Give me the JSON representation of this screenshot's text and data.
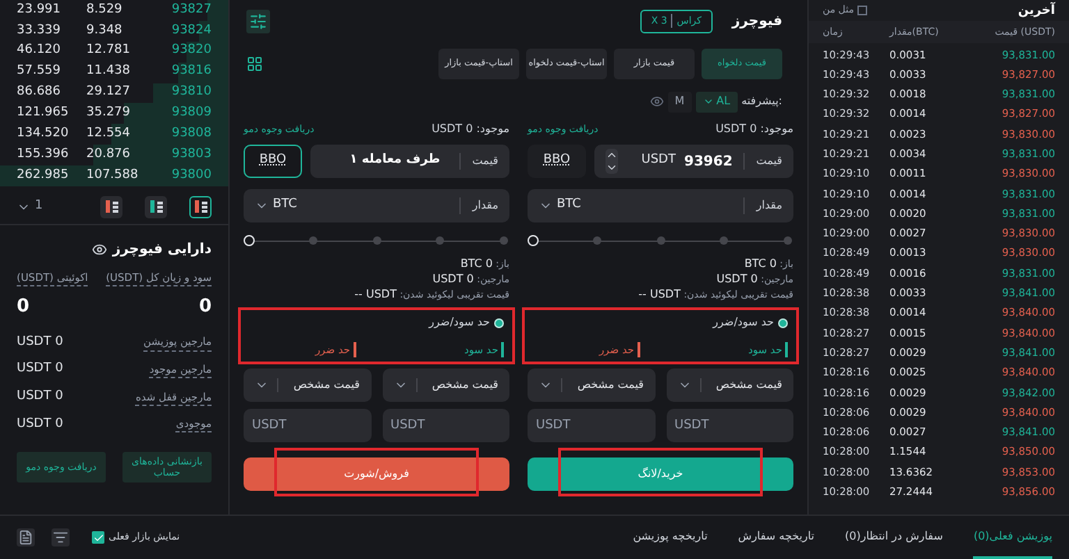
{
  "order_book": {
    "rows": [
      {
        "total": "23.991",
        "amount": "8.529",
        "price": "93827",
        "level": 0.09
      },
      {
        "total": "33.339",
        "amount": "9.348",
        "price": "93824",
        "level": 0.13
      },
      {
        "total": "46.120",
        "amount": "12.781",
        "price": "93820",
        "level": 0.18
      },
      {
        "total": "57.559",
        "amount": "11.438",
        "price": "93816",
        "level": 0.22
      },
      {
        "total": "86.686",
        "amount": "29.127",
        "price": "93810",
        "level": 0.33
      },
      {
        "total": "121.965",
        "amount": "35.279",
        "price": "93809",
        "level": 0.46
      },
      {
        "total": "134.520",
        "amount": "12.554",
        "price": "93808",
        "level": 0.51
      },
      {
        "total": "155.396",
        "amount": "20.876",
        "price": "93803",
        "level": 0.59
      },
      {
        "total": "262.985",
        "amount": "107.588",
        "price": "93800",
        "level": 1
      }
    ],
    "precision": "1",
    "layouts": [
      {
        "kind": "both",
        "selected": false
      },
      {
        "kind": "bids",
        "selected": false
      },
      {
        "kind": "asks",
        "selected": true
      }
    ]
  },
  "assets": {
    "title": "دارایی فیوچرز",
    "pnl_label": "سود و زیان کل (USDT)",
    "equity_label": "اکوئیتی (USDT)",
    "pnl": "0",
    "equity": "0",
    "rows": [
      {
        "label": "مارجین پوزیشن",
        "value": "USDT 0"
      },
      {
        "label": "مارجین موجود",
        "value": "USDT 0"
      },
      {
        "label": "مارجین قفل شده",
        "value": "USDT 0"
      },
      {
        "label": "موجودی",
        "value": "USDT 0"
      }
    ],
    "buttons": [
      "بازنشانی داده‌های حساب",
      "دریافت وجوه دمو"
    ]
  },
  "show_current_market": {
    "label": "نمایش بازار فعلی",
    "checked": true
  },
  "order_panel": {
    "title": "فیوچرز",
    "margin_mode": "کراس",
    "leverage": "X 3",
    "order_types": [
      {
        "label": "قیمت دلخواه",
        "selected": true
      },
      {
        "label": "قیمت بازار",
        "selected": false
      },
      {
        "label": "استاپ-قیمت دلخواه",
        "selected": false
      },
      {
        "label": "استاپ-قیمت بازار",
        "selected": false
      }
    ],
    "advanced_label": "پیشرفته:",
    "advanced_options": [
      {
        "label": "AL",
        "selected": true
      },
      {
        "label": "M",
        "selected": false
      }
    ],
    "sides": [
      {
        "kind": "buy",
        "available_label": "موجود:",
        "available": "USDT 0",
        "demo_link": "دریافت وجوه دمو",
        "price_label": "قیمت",
        "price": "93962",
        "price_unit": "USDT",
        "bbo": "BBO",
        "bbo_selected": false,
        "amount_label": "مقدار",
        "amount_unit": "BTC",
        "level": 0,
        "info": [
          {
            "label": "باز:",
            "value": "BTC 0"
          },
          {
            "label": "مارجین:",
            "value": "USDT 0"
          },
          {
            "label": "قیمت تقریبی لیکوئید شدن:",
            "value": "-- USDT"
          }
        ],
        "tpsl": {
          "label": "حد سود/ضرر",
          "on": true,
          "take_profit": "حد سود",
          "stop_loss": "حد ضرر",
          "highlighted": true
        },
        "price_types": [
          "قیمت مشخص",
          "قیمت مشخص"
        ],
        "placeholders": [
          "USDT",
          "USDT"
        ],
        "submit": "خرید/لانگ",
        "submit_highlighted": true
      },
      {
        "kind": "sell",
        "available_label": "موجود:",
        "available": "USDT 0",
        "demo_link": "دریافت وجوه دمو",
        "price_label": "قیمت",
        "price": "طرف معامله ۱",
        "bbo": "BBO",
        "bbo_selected": true,
        "amount_label": "مقدار",
        "amount_unit": "BTC",
        "level": 0,
        "info": [
          {
            "label": "باز:",
            "value": "BTC 0"
          },
          {
            "label": "مارجین:",
            "value": "USDT 0"
          },
          {
            "label": "قیمت تقریبی لیکوئید شدن:",
            "value": "-- USDT"
          }
        ],
        "tpsl": {
          "label": "حد سود/ضرر",
          "on": true,
          "take_profit": "حد سود",
          "stop_loss": "حد ضرر",
          "highlighted": true
        },
        "price_types": [
          "قیمت مشخص",
          "قیمت مشخص"
        ],
        "placeholders": [
          "USDT",
          "USDT"
        ],
        "submit": "فروش/شورت",
        "submit_highlighted": true
      }
    ]
  },
  "trades": {
    "title": "آخرین",
    "filter": {
      "label": "مثل من",
      "checked": false
    },
    "columns": [
      "قیمت (USDT)",
      "مقدار(BTC)",
      "زمان"
    ],
    "rows": [
      {
        "price": "93,831.00",
        "amount": "0.0031",
        "time": "10:29:43",
        "kind": "buy"
      },
      {
        "price": "93,827.00",
        "amount": "0.0033",
        "time": "10:29:43",
        "kind": "sell"
      },
      {
        "price": "93,831.00",
        "amount": "0.0018",
        "time": "10:29:32",
        "kind": "buy"
      },
      {
        "price": "93,827.00",
        "amount": "0.0014",
        "time": "10:29:32",
        "kind": "sell"
      },
      {
        "price": "93,830.00",
        "amount": "0.0023",
        "time": "10:29:21",
        "kind": "sell"
      },
      {
        "price": "93,831.00",
        "amount": "0.0034",
        "time": "10:29:21",
        "kind": "buy"
      },
      {
        "price": "93,830.00",
        "amount": "0.0011",
        "time": "10:29:10",
        "kind": "sell"
      },
      {
        "price": "93,831.00",
        "amount": "0.0014",
        "time": "10:29:10",
        "kind": "buy"
      },
      {
        "price": "93,831.00",
        "amount": "0.0020",
        "time": "10:29:00",
        "kind": "buy"
      },
      {
        "price": "93,830.00",
        "amount": "0.0027",
        "time": "10:29:00",
        "kind": "sell"
      },
      {
        "price": "93,830.00",
        "amount": "0.0013",
        "time": "10:28:49",
        "kind": "sell"
      },
      {
        "price": "93,831.00",
        "amount": "0.0016",
        "time": "10:28:49",
        "kind": "buy"
      },
      {
        "price": "93,841.00",
        "amount": "0.0033",
        "time": "10:28:38",
        "kind": "buy"
      },
      {
        "price": "93,840.00",
        "amount": "0.0014",
        "time": "10:28:38",
        "kind": "sell"
      },
      {
        "price": "93,840.00",
        "amount": "0.0015",
        "time": "10:28:27",
        "kind": "sell"
      },
      {
        "price": "93,841.00",
        "amount": "0.0029",
        "time": "10:28:27",
        "kind": "buy"
      },
      {
        "price": "93,840.00",
        "amount": "0.0025",
        "time": "10:28:16",
        "kind": "sell"
      },
      {
        "price": "93,842.00",
        "amount": "0.0029",
        "time": "10:28:16",
        "kind": "buy"
      },
      {
        "price": "93,840.00",
        "amount": "0.0029",
        "time": "10:28:06",
        "kind": "sell"
      },
      {
        "price": "93,841.00",
        "amount": "0.0027",
        "time": "10:28:06",
        "kind": "buy"
      },
      {
        "price": "93,850.00",
        "amount": "1.1544",
        "time": "10:28:00",
        "kind": "sell"
      },
      {
        "price": "93,853.00",
        "amount": "13.6362",
        "time": "10:28:00",
        "kind": "sell"
      },
      {
        "price": "93,856.00",
        "amount": "27.2444",
        "time": "10:28:00",
        "kind": "sell"
      }
    ]
  },
  "bottom_tabs": [
    {
      "label": "پوزیشن فعلی(0)",
      "selected": true
    },
    {
      "label": "سفارش در انتظار(0)",
      "selected": false
    },
    {
      "label": "تاریخچه سفارش",
      "selected": false
    },
    {
      "label": "تاریخچه پوزیشن",
      "selected": false
    }
  ]
}
